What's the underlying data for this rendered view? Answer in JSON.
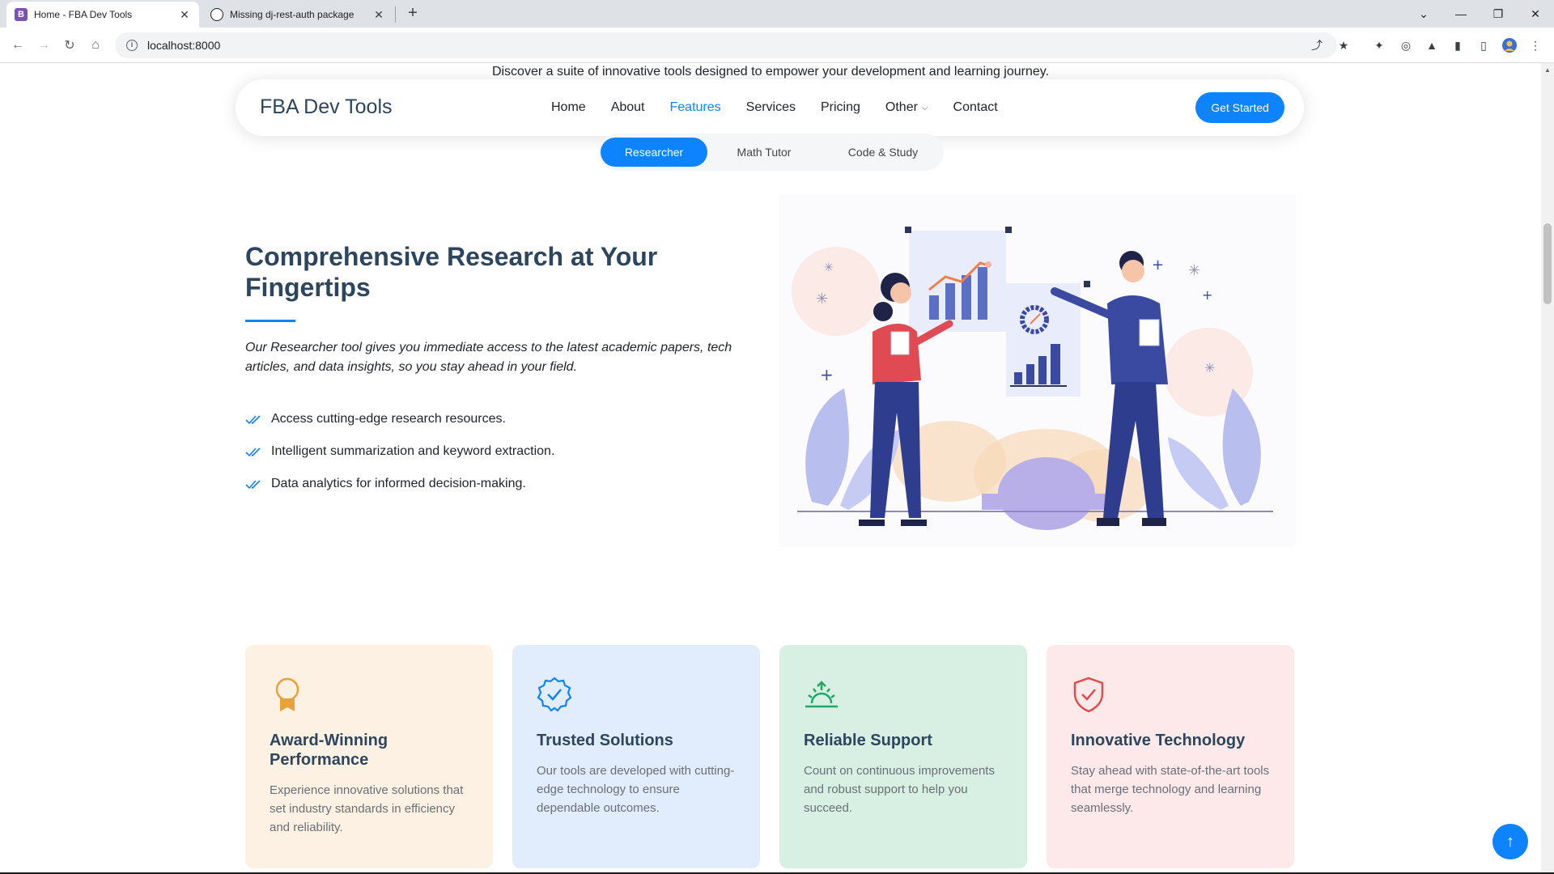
{
  "browser": {
    "tabs": [
      {
        "title": "Home - FBA Dev Tools",
        "icon": "bootstrap-favicon",
        "favicon_glyph": "B",
        "active": true
      },
      {
        "title": "Missing dj-rest-auth package",
        "icon": "openai-favicon",
        "active": false
      }
    ],
    "address": "localhost:8000"
  },
  "page": {
    "intro": "Discover a suite of innovative tools designed to empower your development and learning journey.",
    "logo": "FBA Dev Tools",
    "nav": {
      "home": "Home",
      "about": "About",
      "features": "Features",
      "services": "Services",
      "pricing": "Pricing",
      "other": "Other",
      "contact": "Contact"
    },
    "cta": "Get Started",
    "tabs": [
      "Researcher",
      "Math Tutor",
      "Code & Study"
    ],
    "heading": "Comprehensive Research at Your Fingertips",
    "lead": "Our Researcher tool gives you immediate access to the latest academic papers, tech articles, and data insights, so you stay ahead in your field.",
    "list": [
      "Access cutting-edge research resources.",
      "Intelligent summarization and keyword extraction.",
      "Data analytics for informed decision-making."
    ],
    "cards": [
      {
        "title": "Award-Winning Performance",
        "text": "Experience innovative solutions that set industry standards in efficiency and reliability.",
        "bg": "#fdf1e3",
        "color": "#e8a23a",
        "icon": "award-icon"
      },
      {
        "title": "Trusted Solutions",
        "text": "Our tools are developed with cutting-edge technology to ensure dependable outcomes.",
        "bg": "#e1edfc",
        "color": "#0d83fd",
        "icon": "patch-check-icon"
      },
      {
        "title": "Reliable Support",
        "text": "Count on continuous improvements and robust support to help you succeed.",
        "bg": "#d8f0e4",
        "color": "#23a764",
        "icon": "sunrise-icon"
      },
      {
        "title": "Innovative Technology",
        "text": "Stay ahead with state-of-the-art tools that merge technology and learning seamlessly.",
        "bg": "#fde9e9",
        "color": "#e34b4b",
        "icon": "shield-check-icon"
      }
    ]
  },
  "colors": {
    "accent": "#0d83fd",
    "heading": "#2d465e"
  }
}
